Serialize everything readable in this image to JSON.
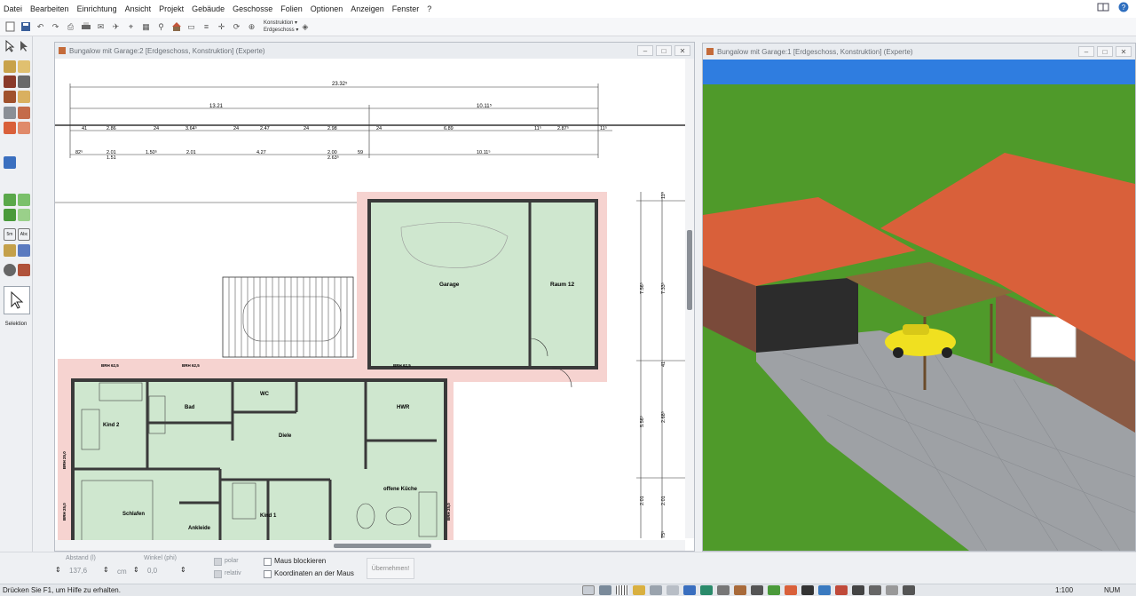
{
  "menu": [
    "Datei",
    "Bearbeiten",
    "Einrichtung",
    "Ansicht",
    "Projekt",
    "Gebäude",
    "Geschosse",
    "Folien",
    "Optionen",
    "Anzeigen",
    "Fenster",
    "?"
  ],
  "toolbar": {
    "layer_select": "Konstruktion",
    "floor_select": "Erdgeschoss"
  },
  "palette": {
    "selection_label": "Selektion"
  },
  "plan_window": {
    "title": "Bungalow mit Garage:2 [Erdgeschoss, Konstruktion] (Experte)",
    "dims_top": {
      "total": "23.32⁵",
      "left": "13.21",
      "right": "10.11⁵",
      "row3": [
        "41",
        "2.86",
        "24",
        "3.64⁵",
        "24",
        "2.47",
        "24",
        "2.98",
        "24",
        "6.89",
        "11⁵",
        "2.87⁵",
        "11⁵"
      ],
      "row4": [
        "82⁵",
        "2.01",
        "1.51",
        "1.50⁵",
        "2.01",
        "4.27",
        "2.00",
        "2.63⁵",
        "59",
        "10.11⁵"
      ]
    },
    "dims_right": [
      "11⁵",
      "7.56⁵",
      "7.33⁵",
      "41",
      "5.56⁵",
      "2.68⁵",
      "2.01",
      "2.01",
      "75⁵"
    ],
    "brh": [
      "BRH 62,5",
      "BRH 62,5",
      "BRH 62,5",
      "BRH 25,0",
      "BRH 25,0",
      "BRH 25,0"
    ],
    "rooms": [
      "Garage",
      "Raum 12",
      "Kind 2",
      "Bad",
      "WC",
      "Diele",
      "HWR",
      "offene Küche",
      "Schlafen",
      "Ankleide",
      "Kind 1"
    ]
  },
  "view3d_window": {
    "title": "Bungalow mit Garage:1 [Erdgeschoss, Konstruktion] (Experte)"
  },
  "coords": {
    "distance_label": "Abstand (l)",
    "distance_value": "137,6",
    "distance_unit": "cm",
    "angle_label": "Winkel (phi)",
    "angle_value": "0,0",
    "polar_label": "polar",
    "relative_label": "relativ",
    "lock_label": "Maus blockieren",
    "mouse_coords_label": "Koordinaten an der Maus",
    "apply_label": "Übernehmen!"
  },
  "status": {
    "message": "Drücken Sie F1, um Hilfe zu erhalten.",
    "scale": "1:100",
    "num": "NUM"
  },
  "colors": {
    "room_fill": "#cfe7cf",
    "wall": "#4a4a4a",
    "roof": "#d9603a",
    "grass": "#4f9a2a",
    "sky": "#2f7de0",
    "pavement": "#9ea1a5"
  }
}
